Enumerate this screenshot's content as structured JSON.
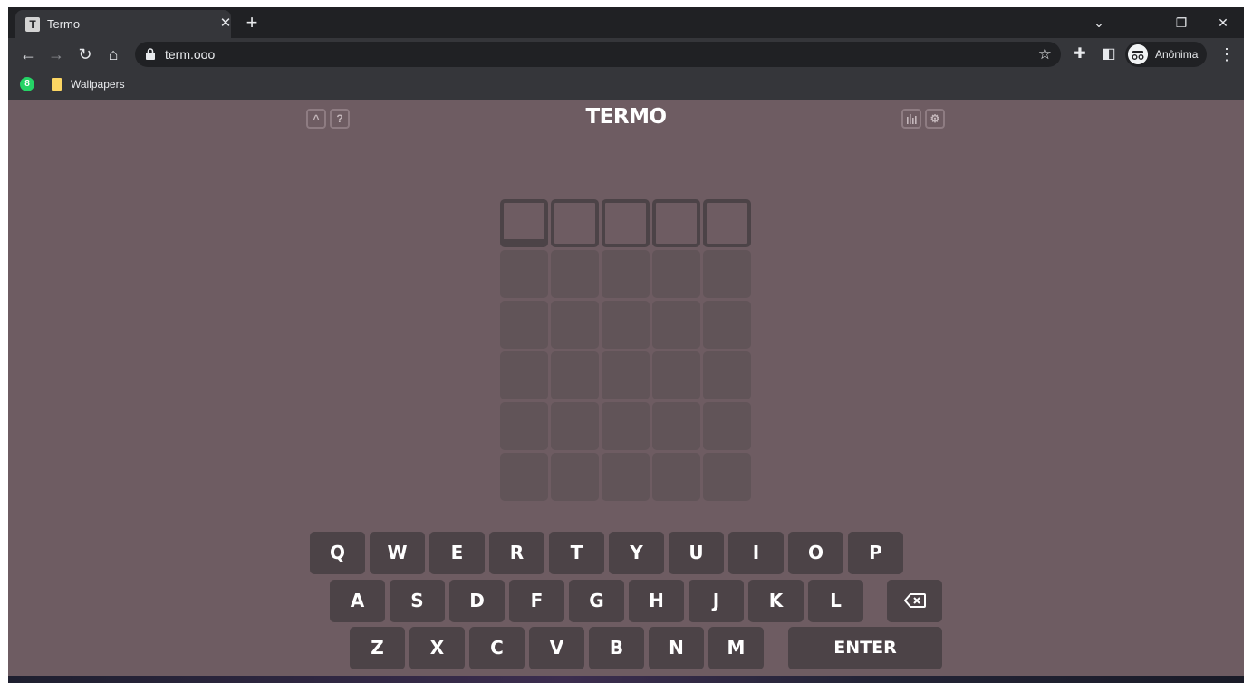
{
  "browser": {
    "tab_title": "Termo",
    "tab_favicon_letter": "T",
    "url": "term.ooo",
    "profile_label": "Anônima",
    "bookmarks": [
      {
        "icon": "whatsapp-icon",
        "badge": "8"
      },
      {
        "icon": "folder-icon",
        "label": "Wallpapers"
      }
    ]
  },
  "game": {
    "title": "TERMO",
    "header_left_icons": [
      "chevron-up-icon",
      "help-icon"
    ],
    "header_right_icons": [
      "stats-icon",
      "settings-icon"
    ],
    "board": {
      "rows": 6,
      "cols": 5,
      "active_row": 0,
      "selected_col": 0
    }
  },
  "keyboard": {
    "row1": [
      "Q",
      "W",
      "E",
      "R",
      "T",
      "Y",
      "U",
      "I",
      "O",
      "P"
    ],
    "row2": [
      "A",
      "S",
      "D",
      "F",
      "G",
      "H",
      "J",
      "K",
      "L"
    ],
    "row3": [
      "Z",
      "X",
      "C",
      "V",
      "B",
      "N",
      "M"
    ],
    "enter_label": "ENTER",
    "backspace_icon": "backspace-icon"
  },
  "colors": {
    "background": "#6e5c62",
    "key": "#4c4347",
    "tile_empty": "#615458"
  }
}
